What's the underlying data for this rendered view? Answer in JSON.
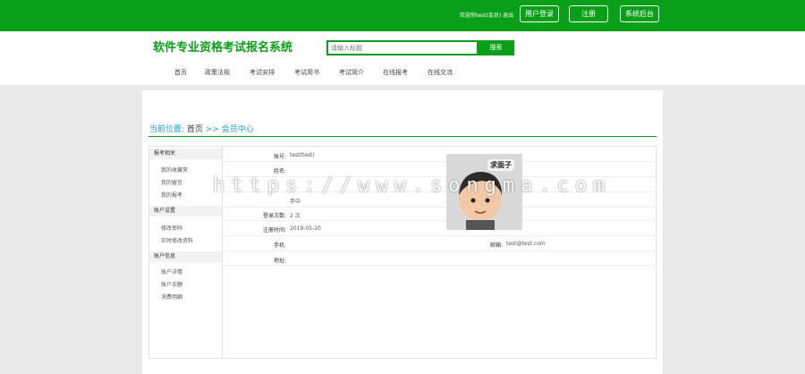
{
  "topbar": {
    "welcome": "欢迎你test(会员) 退出",
    "buttons": [
      "用户登录",
      "注册",
      "系统后台"
    ]
  },
  "header": {
    "site_title": "软件专业资格考试报名系统",
    "search_placeholder": "请输入标题",
    "search_button": "搜索",
    "nav": [
      "首页",
      "政策法规",
      "考试安排",
      "考试用书",
      "考试简介",
      "在线报考",
      "在线交流"
    ]
  },
  "breadcrumb": {
    "prefix": "当前位置:",
    "home": "首页",
    "sep": " >> ",
    "current": "会员中心"
  },
  "sidebar": {
    "groups": [
      {
        "title": "报考相关",
        "items": [
          "我的收藏夹",
          "我的留言",
          "我的报考"
        ]
      },
      {
        "title": "账户设置",
        "items": [
          "修改密码",
          "实时修改资料"
        ]
      },
      {
        "title": "账户信息",
        "items": [
          "账户详情",
          "账户余额",
          "消费明细"
        ]
      }
    ]
  },
  "profile": {
    "account_label": "账号:",
    "account_value": "test(test)",
    "name_label": "姓名:",
    "id_value": "手中",
    "login_count_label": "登录次数:",
    "login_count_value": "2 次",
    "reg_time_label": "注册时间:",
    "reg_time_value": "2019-05-20",
    "phone_label": "手机:",
    "email_label": "邮箱:",
    "email_value": "test@test.com",
    "address_label": "地址:"
  },
  "avatar": {
    "caption": "求面子"
  },
  "watermark": "https://www.songma.com",
  "colors": {
    "brand_green": "#0a9f18",
    "link_blue": "#1a9bd6"
  }
}
